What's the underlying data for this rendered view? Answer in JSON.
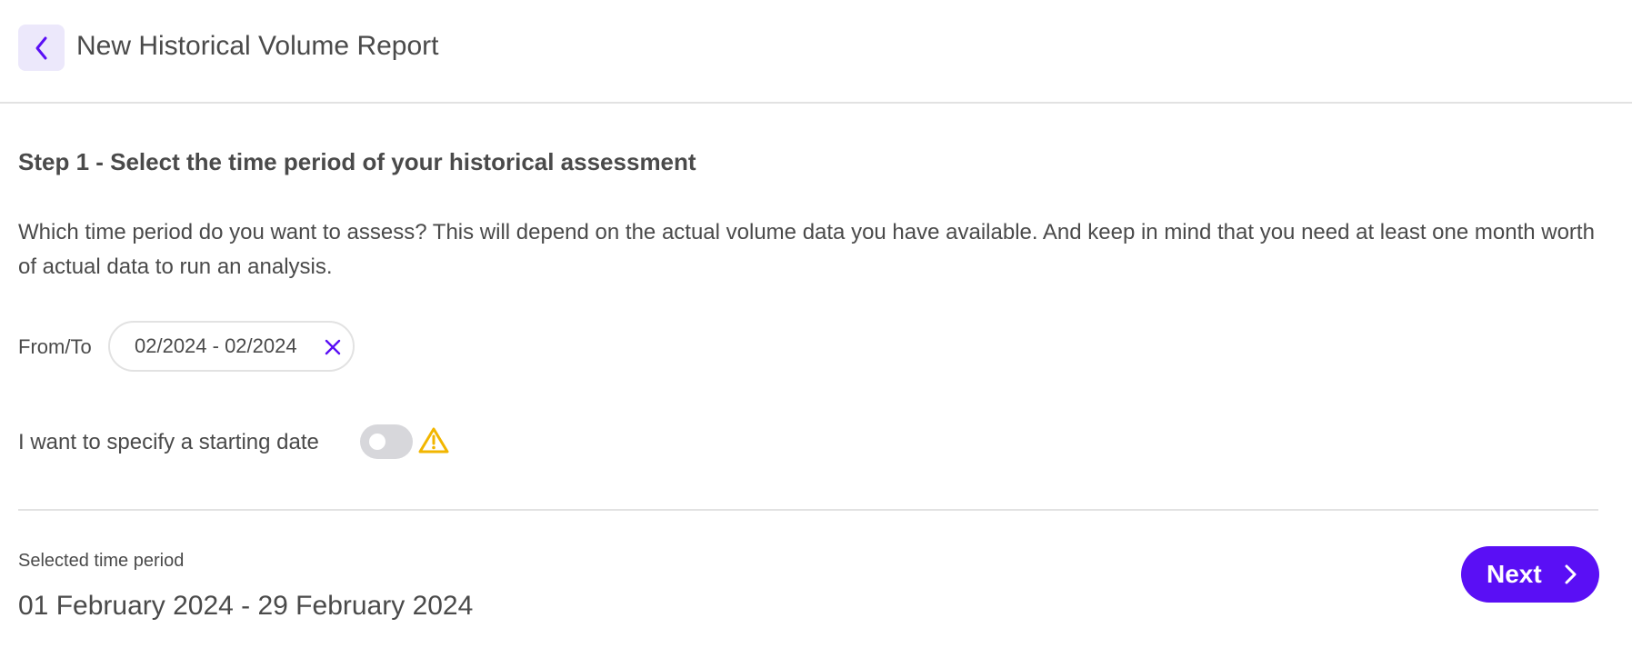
{
  "header": {
    "title": "New Historical Volume Report",
    "back_icon": "chevron-left-icon"
  },
  "step": {
    "title": "Step 1 - Select the time period of your historical assessment",
    "description": "Which time period do you want to assess? This will depend on the actual volume data you have available. And keep in mind that you need at least one month worth of actual data to run an analysis."
  },
  "date_range": {
    "label": "From/To",
    "value": "02/2024 - 02/2024",
    "clear_icon": "close-icon"
  },
  "starting_date": {
    "label": "I want to specify a starting date",
    "toggle_on": false,
    "warning_icon": "warning-icon"
  },
  "summary": {
    "label": "Selected time period",
    "value": "01 February 2024 - 29 February 2024"
  },
  "actions": {
    "next_label": "Next",
    "next_icon": "chevron-right-icon"
  },
  "colors": {
    "accent": "#5a0ff5",
    "accent_light": "#ece8fb",
    "warning": "#f2b600",
    "border": "#e2e2e2",
    "text": "#4a4a4a",
    "toggle_off": "#d7d7db"
  }
}
